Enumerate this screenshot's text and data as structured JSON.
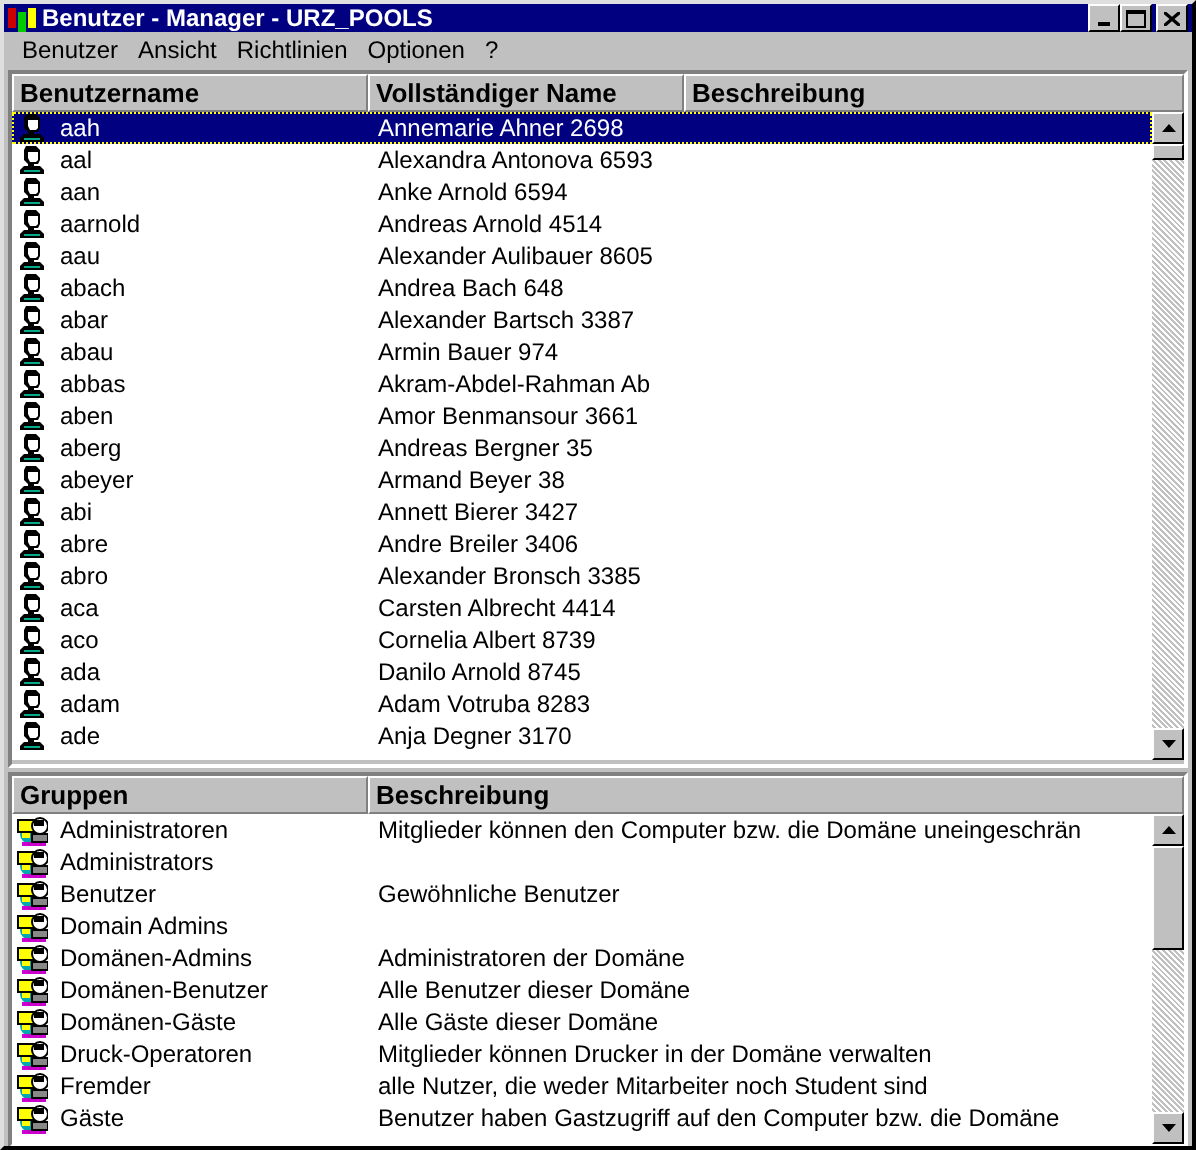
{
  "window": {
    "title": "Benutzer - Manager - URZ_POOLS"
  },
  "menu": [
    "Benutzer",
    "Ansicht",
    "Richtlinien",
    "Optionen",
    "?"
  ],
  "users": {
    "columns": [
      "Benutzername",
      "Vollständiger Name",
      "Beschreibung"
    ],
    "rows": [
      {
        "username": "aah",
        "full_name": "Annemarie Ahner 2698",
        "selected": true
      },
      {
        "username": "aal",
        "full_name": "Alexandra Antonova 6593",
        "selected": false
      },
      {
        "username": "aan",
        "full_name": "Anke Arnold 6594",
        "selected": false
      },
      {
        "username": "aarnold",
        "full_name": "Andreas Arnold 4514",
        "selected": false
      },
      {
        "username": "aau",
        "full_name": "Alexander Aulibauer 8605",
        "selected": false
      },
      {
        "username": "abach",
        "full_name": "Andrea Bach 648",
        "selected": false
      },
      {
        "username": "abar",
        "full_name": "Alexander Bartsch 3387",
        "selected": false
      },
      {
        "username": "abau",
        "full_name": "Armin Bauer 974",
        "selected": false
      },
      {
        "username": "abbas",
        "full_name": "Akram-Abdel-Rahman Ab",
        "selected": false
      },
      {
        "username": "aben",
        "full_name": "Amor Benmansour 3661",
        "selected": false
      },
      {
        "username": "aberg",
        "full_name": "Andreas Bergner 35",
        "selected": false
      },
      {
        "username": "abeyer",
        "full_name": "Armand Beyer 38",
        "selected": false
      },
      {
        "username": "abi",
        "full_name": "Annett Bierer 3427",
        "selected": false
      },
      {
        "username": "abre",
        "full_name": "Andre Breiler 3406",
        "selected": false
      },
      {
        "username": "abro",
        "full_name": "Alexander Bronsch 3385",
        "selected": false
      },
      {
        "username": "aca",
        "full_name": "Carsten Albrecht 4414",
        "selected": false
      },
      {
        "username": "aco",
        "full_name": "Cornelia Albert 8739",
        "selected": false
      },
      {
        "username": "ada",
        "full_name": "Danilo Arnold 8745",
        "selected": false
      },
      {
        "username": "adam",
        "full_name": "Adam Votruba 8283",
        "selected": false
      },
      {
        "username": "ade",
        "full_name": "Anja Degner 3170",
        "selected": false
      }
    ]
  },
  "groups": {
    "columns": [
      "Gruppen",
      "Beschreibung"
    ],
    "rows": [
      {
        "name": "Administratoren",
        "description": "Mitglieder können den Computer bzw. die Domäne uneingeschrän",
        "selected": false
      },
      {
        "name": "Administrators",
        "selected": false
      },
      {
        "name": "Benutzer",
        "description": "Gewöhnliche Benutzer",
        "selected": false
      },
      {
        "name": "Domain Admins",
        "selected": false
      },
      {
        "name": "Domänen-Admins",
        "description": "Administratoren der Domäne",
        "selected": false
      },
      {
        "name": "Domänen-Benutzer",
        "description": "Alle Benutzer dieser Domäne",
        "selected": false
      },
      {
        "name": "Domänen-Gäste",
        "description": "Alle Gäste dieser Domäne",
        "selected": false
      },
      {
        "name": "Druck-Operatoren",
        "description": "Mitglieder können Drucker in der Domäne verwalten",
        "selected": false
      },
      {
        "name": "Fremder",
        "description": "alle Nutzer, die weder Mitarbeiter noch Student sind",
        "selected": false
      },
      {
        "name": "Gäste",
        "description": "Benutzer haben Gastzugriff auf den Computer bzw. die Domäne",
        "selected": false
      }
    ]
  }
}
